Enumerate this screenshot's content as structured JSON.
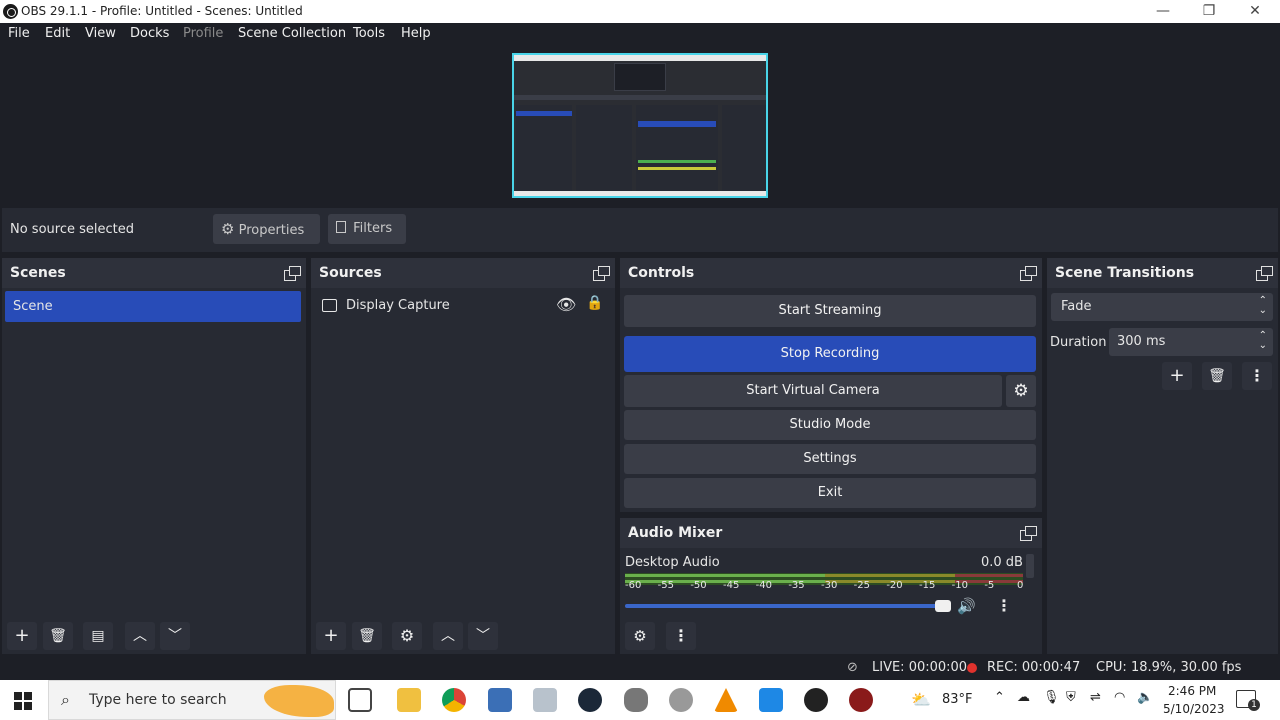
{
  "window": {
    "title": "OBS 29.1.1 - Profile: Untitled - Scenes: Untitled",
    "minimize": "—",
    "restore": "❐",
    "close": "✕"
  },
  "menu": [
    "File",
    "Edit",
    "View",
    "Docks",
    "Profile",
    "Scene Collection",
    "Tools",
    "Help"
  ],
  "context": {
    "no_source": "No source selected",
    "properties": "Properties",
    "filters": "Filters"
  },
  "scenes": {
    "title": "Scenes",
    "items": [
      "Scene"
    ]
  },
  "sources": {
    "title": "Sources",
    "items": [
      "Display Capture"
    ]
  },
  "controls": {
    "title": "Controls",
    "start_streaming": "Start Streaming",
    "stop_recording": "Stop Recording",
    "start_virtual_camera": "Start Virtual Camera",
    "studio_mode": "Studio Mode",
    "settings": "Settings",
    "exit": "Exit"
  },
  "transitions": {
    "title": "Scene Transitions",
    "selected": "Fade",
    "duration_label": "Duration",
    "duration_value": "300 ms"
  },
  "mixer": {
    "title": "Audio Mixer",
    "channel": "Desktop Audio",
    "level": "0.0 dB",
    "scale": [
      "-60",
      "-55",
      "-50",
      "-45",
      "-40",
      "-35",
      "-30",
      "-25",
      "-20",
      "-15",
      "-10",
      "-5",
      "0"
    ],
    "volume_fraction": 1.0
  },
  "status": {
    "live": "LIVE: 00:00:00",
    "rec": "REC: 00:00:47",
    "cpu": "CPU: 18.9%, 30.00 fps"
  },
  "taskbar": {
    "search_placeholder": "Type here to search",
    "weather": "83°F",
    "time": "2:46 PM",
    "date": "5/10/2023",
    "notification_count": "1"
  },
  "colors": {
    "accent": "#284cb8",
    "preview_border": "#49d4e8",
    "rec_dot": "#e0322d",
    "bg": "#1d1f26",
    "panel": "#272a33"
  }
}
